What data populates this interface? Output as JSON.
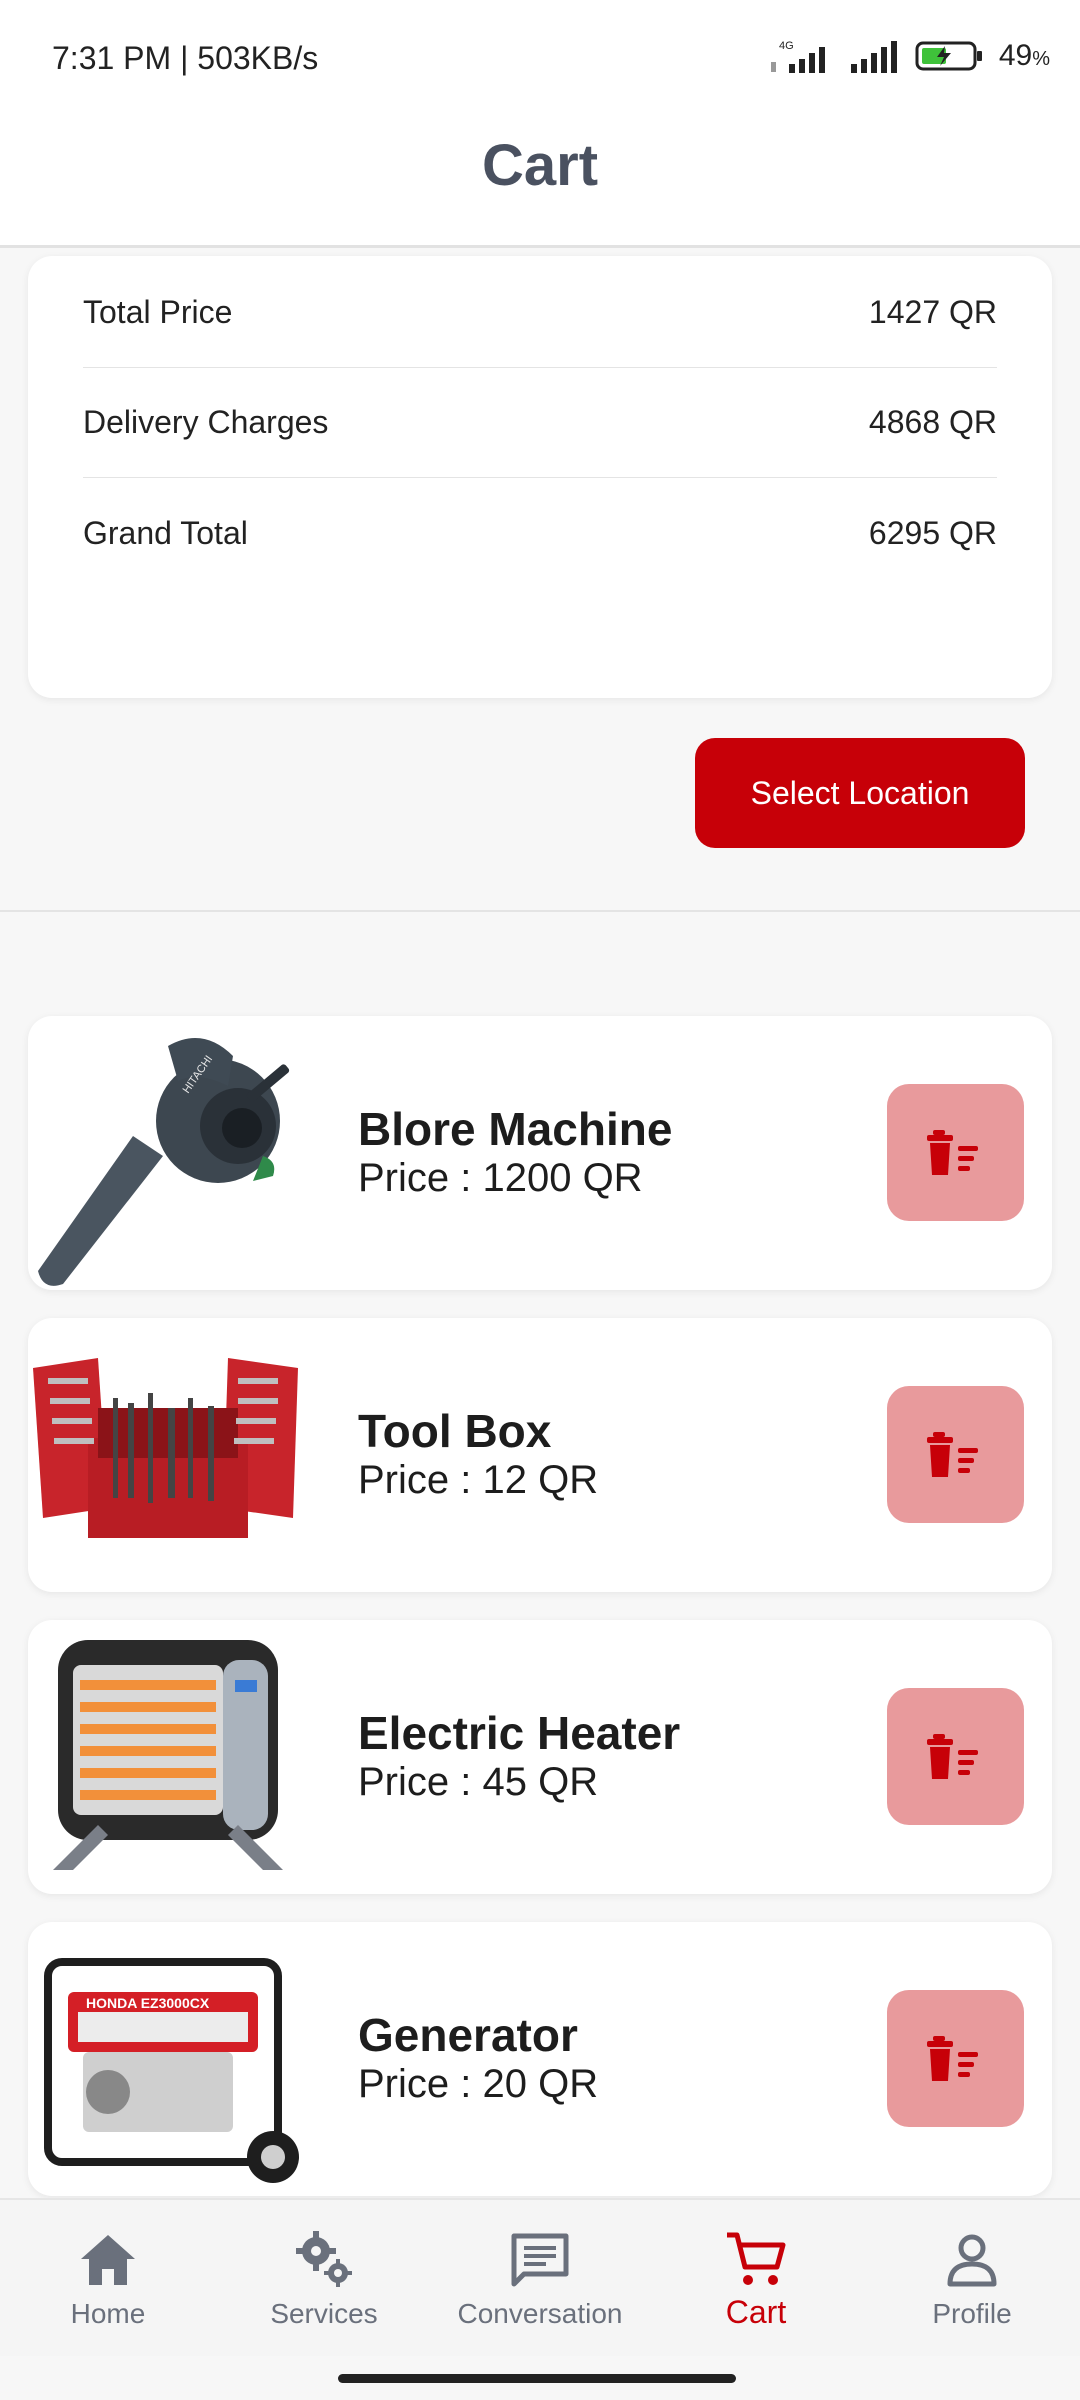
{
  "status_bar": {
    "time": "7:31 PM | 503KB/s",
    "network": "4G",
    "battery": "49",
    "battery_unit": "%"
  },
  "app_bar": {
    "title": "Cart"
  },
  "summary": {
    "rows": [
      {
        "label": "Total Price",
        "value": "1427 QR"
      },
      {
        "label": "Delivery Charges",
        "value": "4868 QR"
      },
      {
        "label": "Grand Total",
        "value": "6295 QR"
      }
    ]
  },
  "select_location_label": "Select Location",
  "items": [
    {
      "name": "Blore Machine",
      "price": "Price : 1200 QR",
      "image": "blower-image",
      "brand": "HITACHI"
    },
    {
      "name": "Tool Box",
      "price": "Price : 12 QR",
      "image": "toolbox-image"
    },
    {
      "name": "Electric Heater",
      "price": "Price : 45 QR",
      "image": "heater-image"
    },
    {
      "name": "Generator",
      "price": "Price : 20 QR",
      "image": "generator-image",
      "brand": "HONDA EZ3000CX"
    }
  ],
  "bottom_nav": {
    "items": [
      {
        "label": "Home",
        "icon": "home-icon"
      },
      {
        "label": "Services",
        "icon": "gears-icon"
      },
      {
        "label": "Conversation",
        "icon": "chat-icon"
      },
      {
        "label": "Cart",
        "icon": "cart-icon",
        "active": true
      },
      {
        "label": "Profile",
        "icon": "person-icon"
      }
    ]
  },
  "colors": {
    "accent": "#c70008",
    "delete_bg": "#e89a9c",
    "title": "#4a5160",
    "nav_inactive": "#6a707c"
  }
}
